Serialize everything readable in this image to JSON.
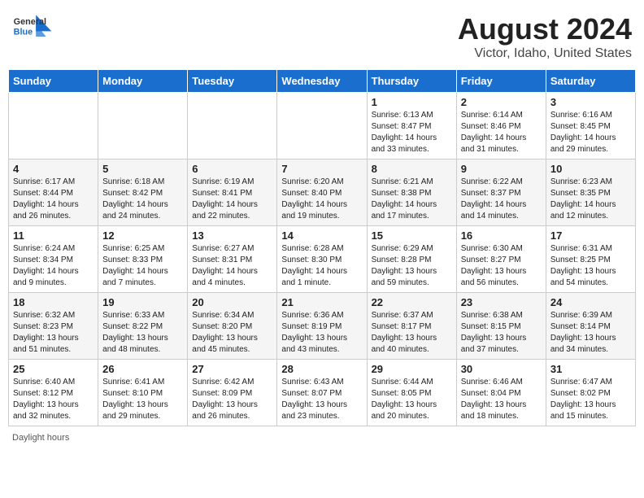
{
  "header": {
    "logo_general": "General",
    "logo_blue": "Blue",
    "month": "August 2024",
    "location": "Victor, Idaho, United States"
  },
  "days_of_week": [
    "Sunday",
    "Monday",
    "Tuesday",
    "Wednesday",
    "Thursday",
    "Friday",
    "Saturday"
  ],
  "weeks": [
    [
      {
        "day": "",
        "info": ""
      },
      {
        "day": "",
        "info": ""
      },
      {
        "day": "",
        "info": ""
      },
      {
        "day": "",
        "info": ""
      },
      {
        "day": "1",
        "info": "Sunrise: 6:13 AM\nSunset: 8:47 PM\nDaylight: 14 hours and 33 minutes."
      },
      {
        "day": "2",
        "info": "Sunrise: 6:14 AM\nSunset: 8:46 PM\nDaylight: 14 hours and 31 minutes."
      },
      {
        "day": "3",
        "info": "Sunrise: 6:16 AM\nSunset: 8:45 PM\nDaylight: 14 hours and 29 minutes."
      }
    ],
    [
      {
        "day": "4",
        "info": "Sunrise: 6:17 AM\nSunset: 8:44 PM\nDaylight: 14 hours and 26 minutes."
      },
      {
        "day": "5",
        "info": "Sunrise: 6:18 AM\nSunset: 8:42 PM\nDaylight: 14 hours and 24 minutes."
      },
      {
        "day": "6",
        "info": "Sunrise: 6:19 AM\nSunset: 8:41 PM\nDaylight: 14 hours and 22 minutes."
      },
      {
        "day": "7",
        "info": "Sunrise: 6:20 AM\nSunset: 8:40 PM\nDaylight: 14 hours and 19 minutes."
      },
      {
        "day": "8",
        "info": "Sunrise: 6:21 AM\nSunset: 8:38 PM\nDaylight: 14 hours and 17 minutes."
      },
      {
        "day": "9",
        "info": "Sunrise: 6:22 AM\nSunset: 8:37 PM\nDaylight: 14 hours and 14 minutes."
      },
      {
        "day": "10",
        "info": "Sunrise: 6:23 AM\nSunset: 8:35 PM\nDaylight: 14 hours and 12 minutes."
      }
    ],
    [
      {
        "day": "11",
        "info": "Sunrise: 6:24 AM\nSunset: 8:34 PM\nDaylight: 14 hours and 9 minutes."
      },
      {
        "day": "12",
        "info": "Sunrise: 6:25 AM\nSunset: 8:33 PM\nDaylight: 14 hours and 7 minutes."
      },
      {
        "day": "13",
        "info": "Sunrise: 6:27 AM\nSunset: 8:31 PM\nDaylight: 14 hours and 4 minutes."
      },
      {
        "day": "14",
        "info": "Sunrise: 6:28 AM\nSunset: 8:30 PM\nDaylight: 14 hours and 1 minute."
      },
      {
        "day": "15",
        "info": "Sunrise: 6:29 AM\nSunset: 8:28 PM\nDaylight: 13 hours and 59 minutes."
      },
      {
        "day": "16",
        "info": "Sunrise: 6:30 AM\nSunset: 8:27 PM\nDaylight: 13 hours and 56 minutes."
      },
      {
        "day": "17",
        "info": "Sunrise: 6:31 AM\nSunset: 8:25 PM\nDaylight: 13 hours and 54 minutes."
      }
    ],
    [
      {
        "day": "18",
        "info": "Sunrise: 6:32 AM\nSunset: 8:23 PM\nDaylight: 13 hours and 51 minutes."
      },
      {
        "day": "19",
        "info": "Sunrise: 6:33 AM\nSunset: 8:22 PM\nDaylight: 13 hours and 48 minutes."
      },
      {
        "day": "20",
        "info": "Sunrise: 6:34 AM\nSunset: 8:20 PM\nDaylight: 13 hours and 45 minutes."
      },
      {
        "day": "21",
        "info": "Sunrise: 6:36 AM\nSunset: 8:19 PM\nDaylight: 13 hours and 43 minutes."
      },
      {
        "day": "22",
        "info": "Sunrise: 6:37 AM\nSunset: 8:17 PM\nDaylight: 13 hours and 40 minutes."
      },
      {
        "day": "23",
        "info": "Sunrise: 6:38 AM\nSunset: 8:15 PM\nDaylight: 13 hours and 37 minutes."
      },
      {
        "day": "24",
        "info": "Sunrise: 6:39 AM\nSunset: 8:14 PM\nDaylight: 13 hours and 34 minutes."
      }
    ],
    [
      {
        "day": "25",
        "info": "Sunrise: 6:40 AM\nSunset: 8:12 PM\nDaylight: 13 hours and 32 minutes."
      },
      {
        "day": "26",
        "info": "Sunrise: 6:41 AM\nSunset: 8:10 PM\nDaylight: 13 hours and 29 minutes."
      },
      {
        "day": "27",
        "info": "Sunrise: 6:42 AM\nSunset: 8:09 PM\nDaylight: 13 hours and 26 minutes."
      },
      {
        "day": "28",
        "info": "Sunrise: 6:43 AM\nSunset: 8:07 PM\nDaylight: 13 hours and 23 minutes."
      },
      {
        "day": "29",
        "info": "Sunrise: 6:44 AM\nSunset: 8:05 PM\nDaylight: 13 hours and 20 minutes."
      },
      {
        "day": "30",
        "info": "Sunrise: 6:46 AM\nSunset: 8:04 PM\nDaylight: 13 hours and 18 minutes."
      },
      {
        "day": "31",
        "info": "Sunrise: 6:47 AM\nSunset: 8:02 PM\nDaylight: 13 hours and 15 minutes."
      }
    ]
  ],
  "footer": {
    "daylight_hours_label": "Daylight hours"
  }
}
